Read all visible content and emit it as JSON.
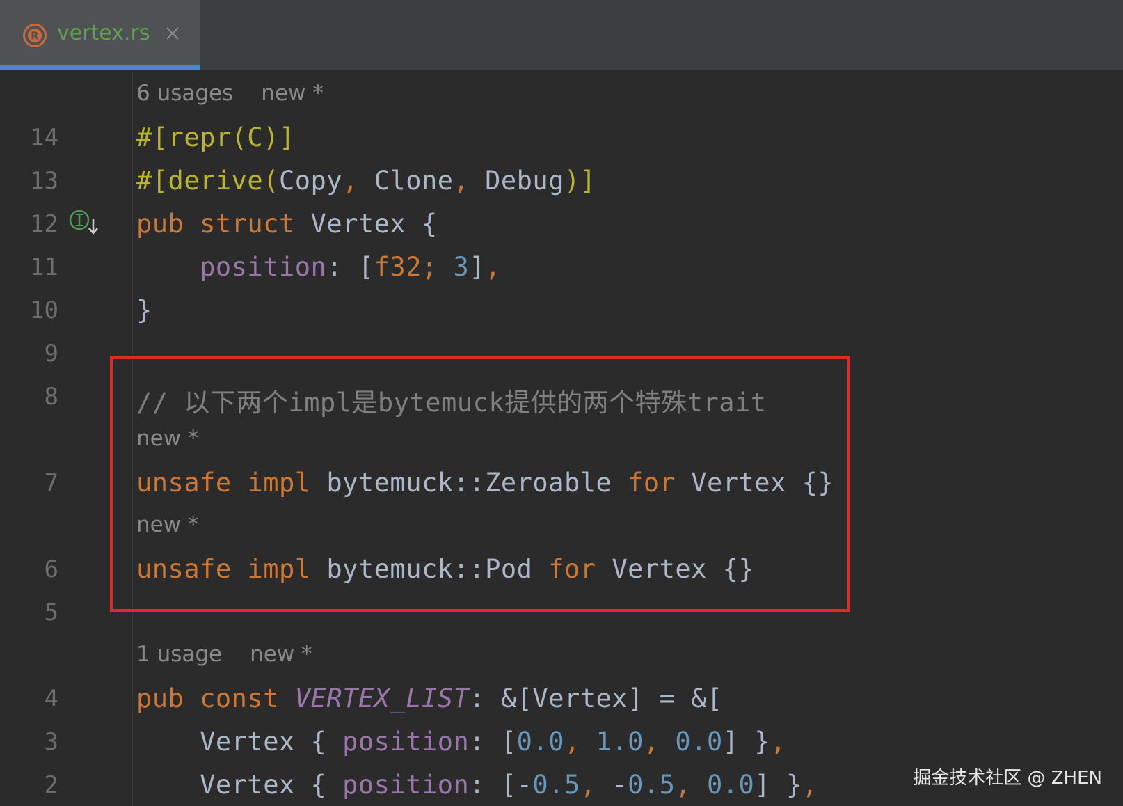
{
  "tab": {
    "title": "vertex.rs",
    "icon": "rust-file-icon",
    "active_color": "#62a04f"
  },
  "hints": {
    "struct_usages": "6 usages",
    "struct_new": "new *",
    "zeroable_new": "new *",
    "pod_new": "new *",
    "const_usages": "1 usage",
    "const_new": "new *"
  },
  "lines": {
    "l14": {
      "number": "14"
    },
    "l13": {
      "number": "13"
    },
    "l12": {
      "number": "12"
    },
    "l11": {
      "number": "11"
    },
    "l10": {
      "number": "10"
    },
    "l9": {
      "number": "9"
    },
    "l8": {
      "number": "8"
    },
    "l7": {
      "number": "7"
    },
    "l6": {
      "number": "6"
    },
    "l5": {
      "number": "5"
    },
    "l4": {
      "number": "4"
    },
    "l3": {
      "number": "3"
    },
    "l2": {
      "number": "2"
    }
  },
  "code": {
    "l14": {
      "attr": "#[repr(C)]"
    },
    "l13": {
      "attr_open": "#[derive(",
      "arg1": "Copy",
      "sep1": ", ",
      "arg2": "Clone",
      "sep2": ", ",
      "arg3": "Debug",
      "attr_close": ")]"
    },
    "l12": {
      "kw1": "pub",
      "kw2": "struct",
      "name": "Vertex",
      "brace": "{"
    },
    "l11": {
      "field": "position",
      "colon": ": [",
      "type": "f32;",
      "num": "3",
      "close": "]",
      "comma": ","
    },
    "l10": {
      "brace": "}"
    },
    "l8": {
      "comment": "// 以下两个impl是bytemuck提供的两个特殊trait"
    },
    "l7": {
      "kw1": "unsafe",
      "kw2": "impl",
      "path": "bytemuck::Zeroable",
      "kw3": "for",
      "name": "Vertex",
      "body": "{}"
    },
    "l6": {
      "kw1": "unsafe",
      "kw2": "impl",
      "path": "bytemuck::Pod",
      "kw3": "for",
      "name": "Vertex",
      "body": "{}"
    },
    "l4": {
      "kw1": "pub",
      "kw2": "const",
      "const": "VERTEX_LIST",
      "rest": ": &[Vertex] = &["
    },
    "l3": {
      "type": "Vertex",
      "open": " { ",
      "field": "position",
      "colon": ": [",
      "n1": "0.0",
      "c1": ", ",
      "n2": "1.0",
      "c2": ", ",
      "n3": "0.0",
      "close": "] }",
      "comma": ","
    },
    "l2": {
      "type": "Vertex",
      "open": " { ",
      "field": "position",
      "colon": ": [",
      "neg1": "-",
      "n1": "0.5",
      "c1": ", ",
      "neg2": "-",
      "n2": "0.5",
      "c2": ", ",
      "n3": "0.0",
      "close": "] }",
      "comma": ","
    }
  },
  "annotation": {
    "color": "#e0282f"
  },
  "watermark": "掘金技术社区 @ ZHEN",
  "colors": {
    "background": "#2b2b2b",
    "keyword": "#cc7832",
    "attribute": "#bbb529",
    "field": "#9876aa",
    "number": "#6897bb",
    "comment": "#808080",
    "text": "#a9b7c6",
    "tab_underline": "#4a88c7"
  }
}
